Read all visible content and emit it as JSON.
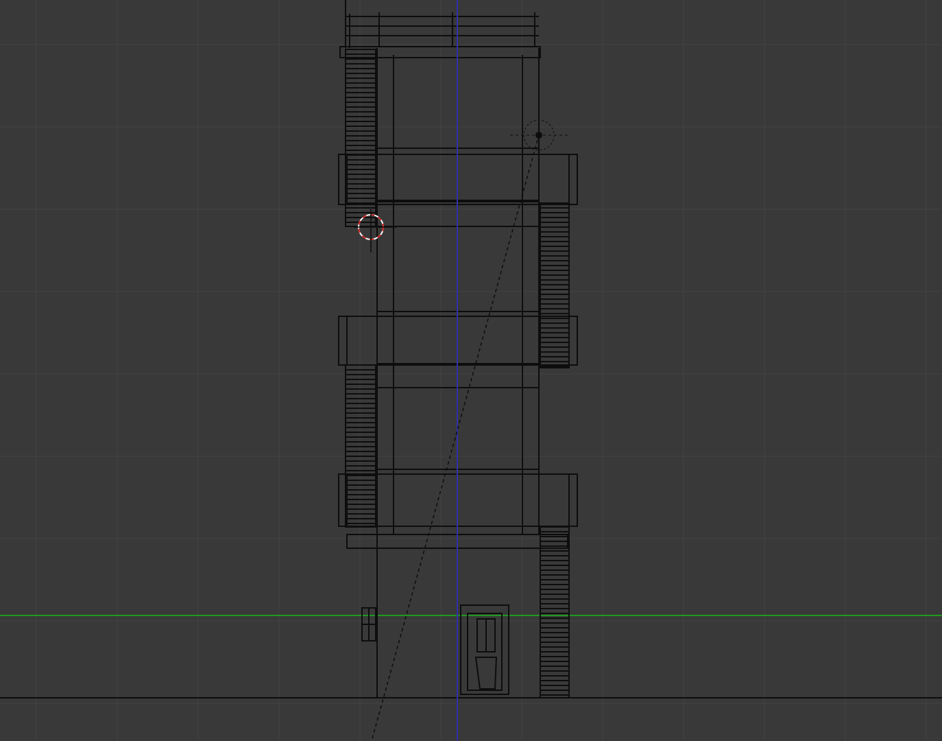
{
  "viewport": {
    "name": "3d-viewport-front-orthographic",
    "background_color": "#393939",
    "grid_color": "#444444",
    "wire_color": "#0d0d0d",
    "x_axis_color": "#1f9a1f",
    "z_axis_color": "#2f2fa8",
    "cursor_color": "#d22222",
    "grid_visible": true,
    "scene_objects": [
      "building-wireframe",
      "left-stairs",
      "right-stairs",
      "roof-railing",
      "front-door",
      "small-window",
      "lamp-object",
      "camera-line",
      "3d-cursor"
    ]
  }
}
